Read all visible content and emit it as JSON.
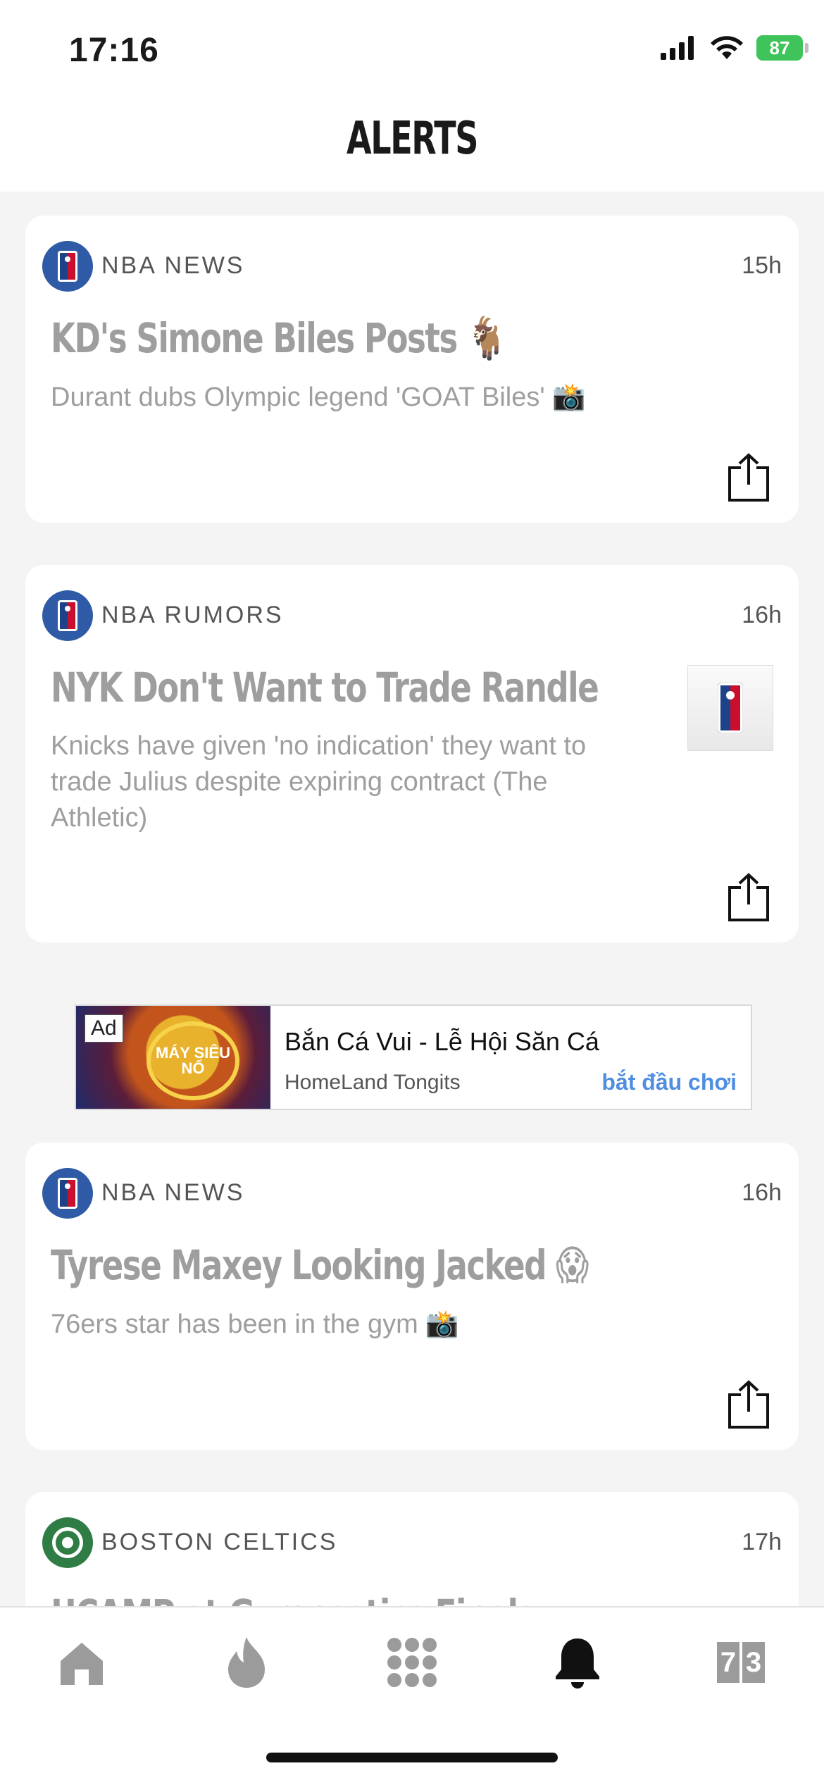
{
  "status_bar": {
    "time": "17:16",
    "battery": "87"
  },
  "header": {
    "title": "ALERTS"
  },
  "alerts": [
    {
      "source": "NBA NEWS",
      "time": "15h",
      "headline": "KD's Simone Biles Posts",
      "headline_emoji": "🐐",
      "summary": "Durant dubs Olympic legend 'GOAT Biles'",
      "summary_emoji": "📸"
    },
    {
      "source": "NBA RUMORS",
      "time": "16h",
      "headline": "NYK Don't Want to Trade Randle",
      "summary": "Knicks have given 'no indication' they want to trade Julius despite expiring contract (The Athletic)"
    },
    {
      "source": "NBA NEWS",
      "time": "16h",
      "headline": "Tyrese Maxey Looking Jacked",
      "headline_emoji": "😱",
      "summary": "76ers star has been in the gym",
      "summary_emoji": "📸"
    },
    {
      "source": "BOSTON CELTICS",
      "time": "17h",
      "headline": "UCAMP at Gymnastics Finals"
    }
  ],
  "ad": {
    "tag": "Ad",
    "title": "Bắn Cá Vui - Lễ Hội Săn Cá",
    "advertiser": "HomeLand Tongits",
    "cta": "bắt đầu chơi",
    "image_text": "MÁY SIÊU NỔ"
  },
  "tab_bar": {
    "items": [
      "home-icon",
      "flame-icon",
      "grid-icon",
      "bell-icon",
      "scores-icon"
    ],
    "active": "bell-icon",
    "scores_digits": [
      "7",
      "3"
    ]
  },
  "colors": {
    "nba_blue": "#2e5aa6",
    "celtics_green": "#2f7d45",
    "cta_blue": "#4f8ee0",
    "battery_green": "#3ec45a"
  }
}
